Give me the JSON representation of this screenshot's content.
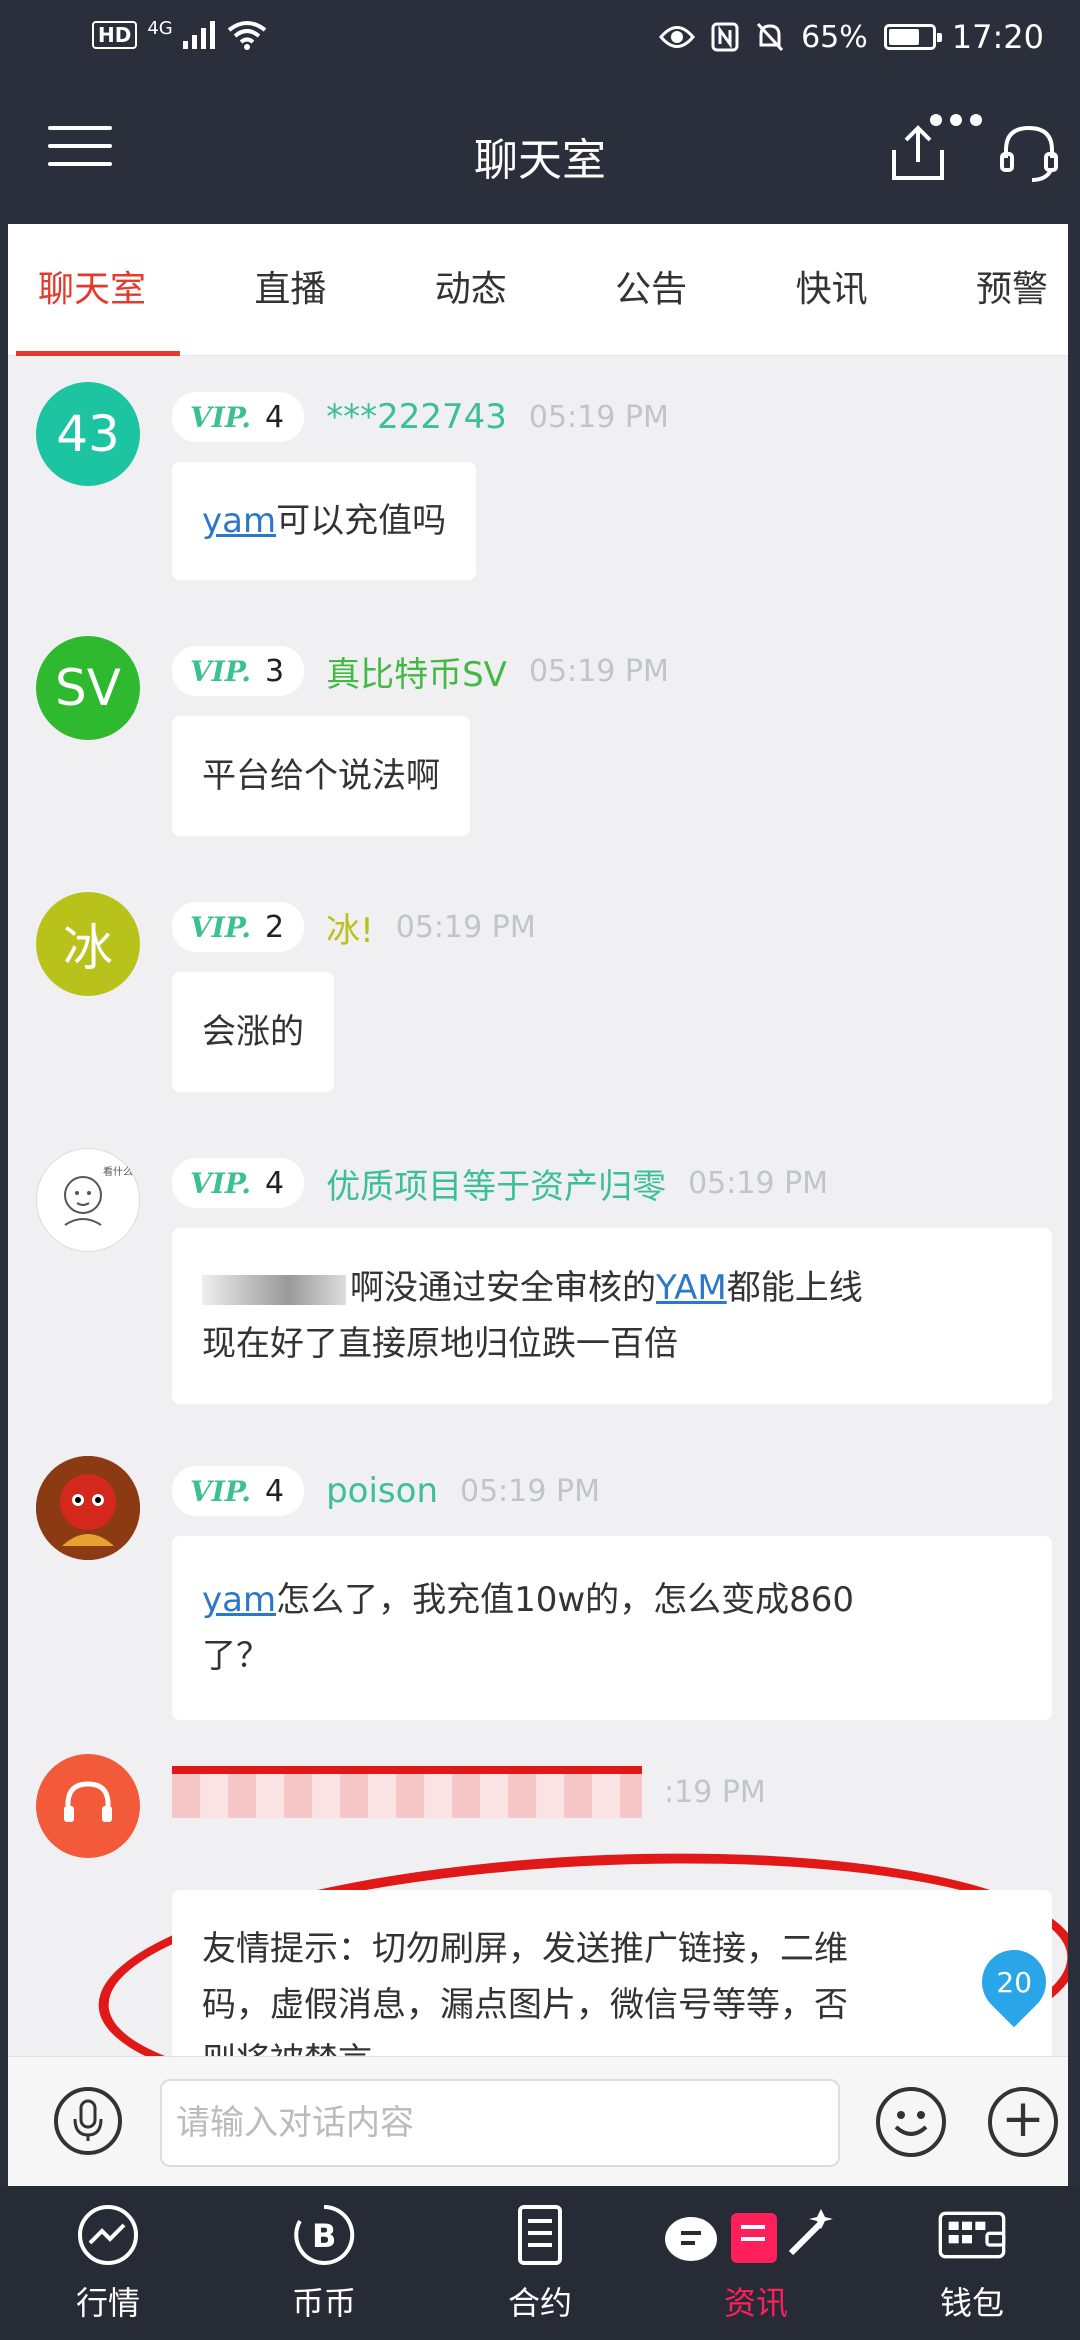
{
  "status_bar": {
    "network": "HD",
    "signal_type": "4G",
    "battery_percent": "65%",
    "battery_level": 0.65,
    "time": "17:20"
  },
  "header": {
    "title": "聊天室"
  },
  "tabs": [
    {
      "label": "聊天室",
      "active": true
    },
    {
      "label": "直播"
    },
    {
      "label": "动态"
    },
    {
      "label": "公告"
    },
    {
      "label": "快讯"
    },
    {
      "label": "预警"
    }
  ],
  "messages": [
    {
      "avatar_text": "43",
      "avatar_color": "#1cc4a2",
      "vip_level": "4",
      "username": "***222743",
      "username_color": "#3cbf95",
      "time": "05:19 PM",
      "keyword": "yam",
      "text": "可以充值吗"
    },
    {
      "avatar_text": "SV",
      "avatar_color": "#2fb92f",
      "vip_level": "3",
      "username": "真比特币SV",
      "username_color": "#44b844",
      "time": "05:19 PM",
      "text": "平台给个说法啊"
    },
    {
      "avatar_text": "冰",
      "avatar_color": "#b9c21a",
      "vip_level": "2",
      "username": "冰!",
      "username_color": "#b9c21a",
      "time": "05:19 PM",
      "text": "会涨的"
    },
    {
      "avatar_icon": "cartoon-avatar",
      "vip_level": "4",
      "username": "优质项目等于资产归零",
      "username_color": "#3cbf95",
      "time": "05:19 PM",
      "pre": "啊没通过安全审核的",
      "keyword": "YAM",
      "text_after": "都能上线",
      "text_line2": "现在好了直接原地归位跌一百倍"
    },
    {
      "avatar_icon": "red-character-avatar",
      "vip_level": "4",
      "username": "poison",
      "username_color": "#3cbf95",
      "time": "05:19 PM",
      "keyword": "yam",
      "text": "怎么了，我充值10w的，怎么变成860",
      "text_line2": "了？"
    },
    {
      "avatar_icon": "headset-support-avatar",
      "avatar_color": "#f25a3a",
      "time": ":19 PM",
      "text": "友情提示：切勿刷屏，发送推广链接，二维",
      "text_line2": "码，虚假消息，漏点图片，微信号等等，否",
      "text_line3": "则将被禁言。"
    }
  ],
  "vip_mark": "VIP.",
  "unread_badge": "20",
  "input": {
    "placeholder": "请输入对话内容"
  },
  "bottom_nav": [
    {
      "label": "行情",
      "icon": "trend-icon"
    },
    {
      "label": "币币",
      "icon": "bitcoin-icon"
    },
    {
      "label": "合约",
      "icon": "document-icon"
    },
    {
      "label": "资讯",
      "icon": "news-icon",
      "active": true
    },
    {
      "label": "钱包",
      "icon": "wallet-icon"
    }
  ]
}
